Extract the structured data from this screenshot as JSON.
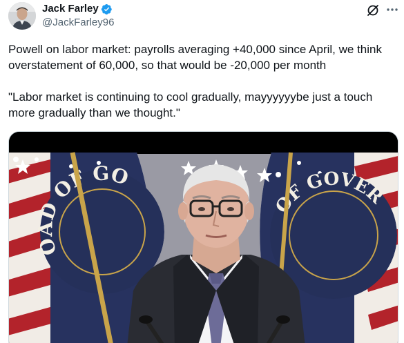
{
  "author": {
    "display_name": "Jack Farley",
    "handle": "@JackFarley96",
    "avatar_icon": "profile-photo",
    "verified_icon": "verified-badge-icon",
    "verified_color": "#1d9bf0"
  },
  "header_actions": {
    "grok_icon": "grok-icon",
    "more_icon": "more-dots-icon"
  },
  "tweet": {
    "paragraph_1_line_1": "Powell on labor market: payrolls averaging +40,000 since April, we think",
    "paragraph_1_line_2": "overstatement of 60,000, so that would be -20,000 per month",
    "paragraph_2_line_1": "\"Labor market is continuing to cool gradually, mayyyyyybe just a touch",
    "paragraph_2_line_2": "more gradually than we thought.\""
  },
  "media": {
    "seal_text_left": "OAD OF GO",
    "seal_text_right": "OF GOVER"
  }
}
